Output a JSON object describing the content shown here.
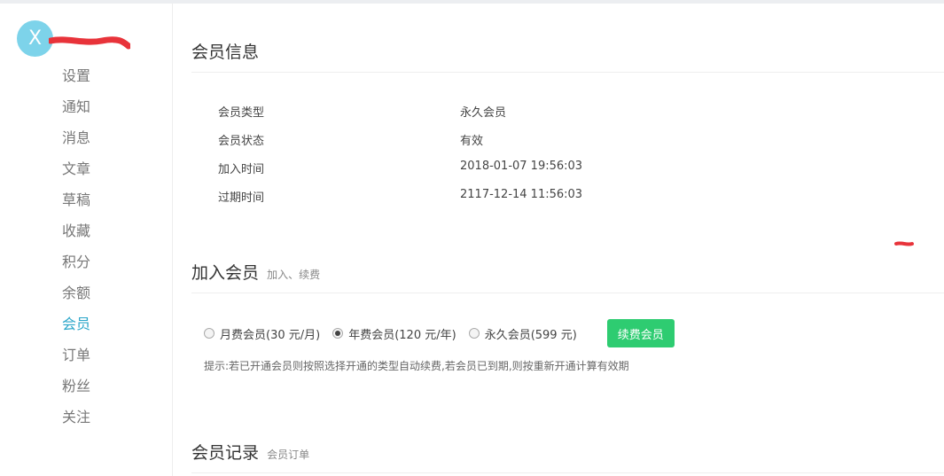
{
  "user": {
    "avatar_letter": "X"
  },
  "sidebar": {
    "items": [
      {
        "label": "设置"
      },
      {
        "label": "通知"
      },
      {
        "label": "消息"
      },
      {
        "label": "文章"
      },
      {
        "label": "草稿"
      },
      {
        "label": "收藏"
      },
      {
        "label": "积分"
      },
      {
        "label": "余额"
      },
      {
        "label": "会员",
        "active": true
      },
      {
        "label": "订单"
      },
      {
        "label": "粉丝"
      },
      {
        "label": "关注"
      }
    ]
  },
  "member_info": {
    "title": "会员信息",
    "rows": [
      {
        "key": "会员类型",
        "value": "永久会员"
      },
      {
        "key": "会员状态",
        "value": "有效"
      },
      {
        "key": "加入时间",
        "value": "2018-01-07 19:56:03"
      },
      {
        "key": "过期时间",
        "value": "2117-12-14 11:56:03"
      }
    ]
  },
  "join": {
    "title": "加入会员",
    "subtitle": "加入、续费",
    "options": [
      {
        "label": "月费会员(30 元/月)",
        "checked": false
      },
      {
        "label": "年费会员(120 元/年)",
        "checked": true
      },
      {
        "label": "永久会员(599 元)",
        "checked": false
      }
    ],
    "button_label": "续费会员",
    "tip": "提示:若已开通会员则按照选择开通的类型自动续费,若会员已到期,则按重新开通计算有效期"
  },
  "records": {
    "title": "会员记录",
    "subtitle": "会员订单"
  },
  "colors": {
    "accent": "#2aa6c9",
    "button": "#2ecc71",
    "avatar": "#7dd3ea",
    "redaction": "#e8333a"
  }
}
